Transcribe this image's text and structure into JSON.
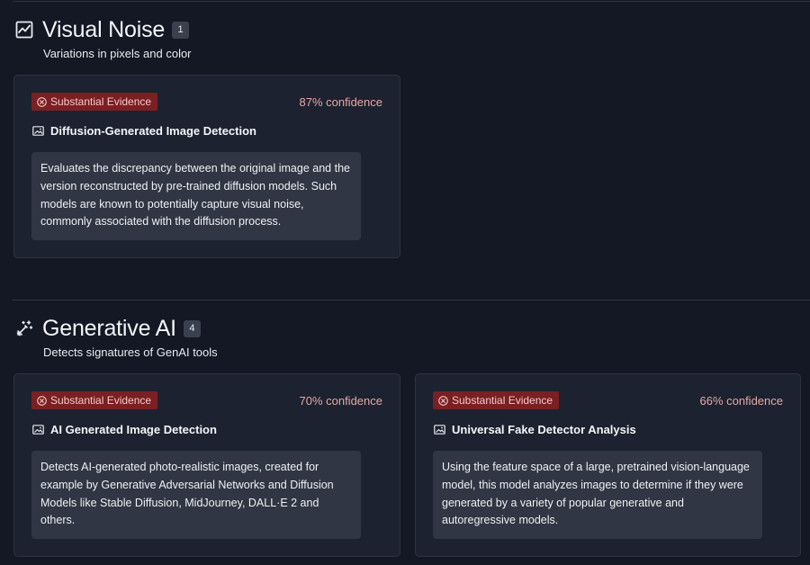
{
  "sections": [
    {
      "title": "Visual Noise",
      "count": "1",
      "subtitle": "Variations in pixels and color",
      "icon": "chart-line-icon",
      "cards": [
        {
          "badge": "Substantial Evidence",
          "confidence": "87% confidence",
          "title": "Diffusion-Generated Image Detection",
          "description": "Evaluates the discrepancy between the original image and the version reconstructed by pre-trained diffusion models. Such models are known to potentially capture visual noise, commonly associated with the diffusion process."
        }
      ]
    },
    {
      "title": "Generative AI",
      "count": "4",
      "subtitle": "Detects signatures of GenAI tools",
      "icon": "magic-wand-icon",
      "cards": [
        {
          "badge": "Substantial Evidence",
          "confidence": "70% confidence",
          "title": "AI Generated Image Detection",
          "description": "Detects AI-generated photo-realistic images, created for example by Generative Adversarial Networks and Diffusion Models like Stable Diffusion, MidJourney, DALL·E 2 and others."
        },
        {
          "badge": "Substantial Evidence",
          "confidence": "66% confidence",
          "title": "Universal Fake Detector Analysis",
          "description": "Using the feature space of a large, pretrained vision-language model, this model analyzes images to determine if they were generated by a variety of popular generative and autoregressive models."
        }
      ]
    }
  ],
  "colors": {
    "background": "#141824",
    "card": "#1d2230",
    "badge": "#7a1f22",
    "confidence": "#e5a8a6",
    "description_box": "#303643"
  }
}
